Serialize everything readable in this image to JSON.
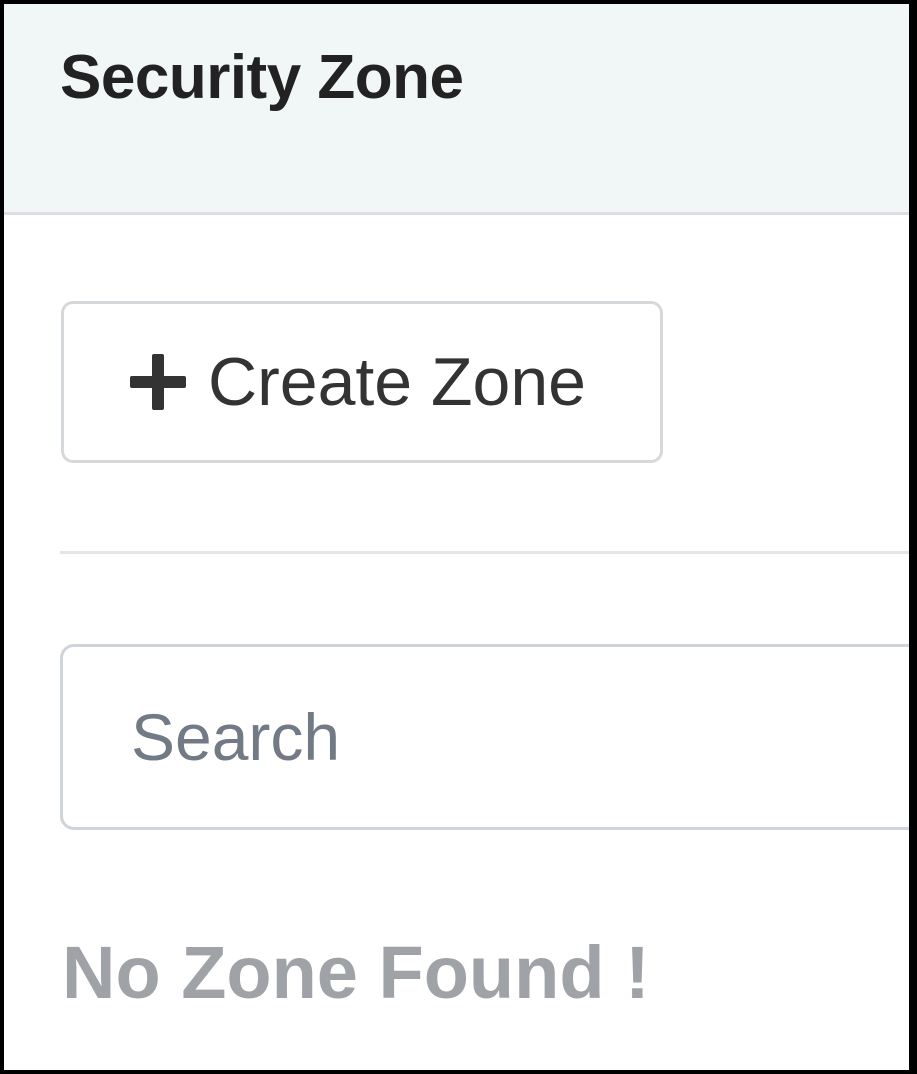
{
  "panel": {
    "title": "Security Zone"
  },
  "toolbar": {
    "create_label": "Create Zone",
    "create_icon": "plus-icon"
  },
  "search": {
    "placeholder": "Search",
    "value": ""
  },
  "results": {
    "empty_message": "No Zone Found !"
  },
  "colors": {
    "header_background": "#f1f7f7",
    "title_text": "#222222",
    "button_text": "#333333",
    "placeholder_text": "#727b85",
    "empty_message_text": "#9fa3a7",
    "border": "#d6d9dc"
  }
}
